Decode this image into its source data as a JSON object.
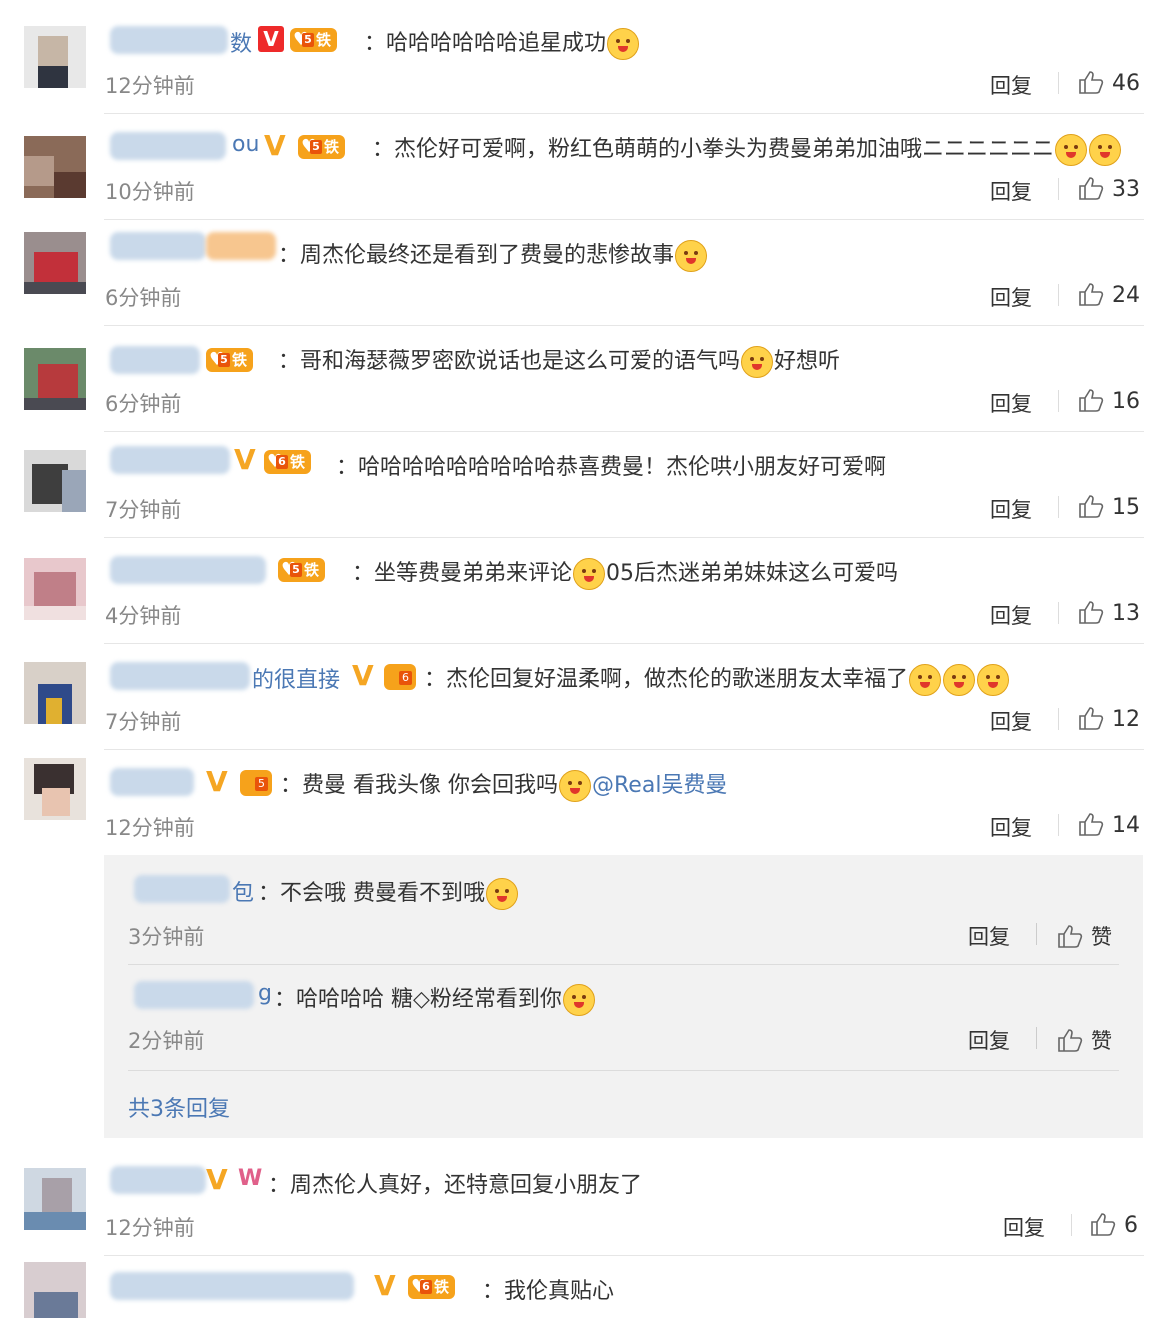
{
  "colors": {
    "link": "#4b78b4",
    "fan_badge": "#f6a21b",
    "v_badge": "#ee2a2a",
    "v_mark": "#f5a623"
  },
  "labels": {
    "reply": "回复",
    "like": "赞",
    "fan_badge_text": "铁粉",
    "fan_level": "5",
    "fan_level_b": "6",
    "v_letter": "V"
  },
  "comments": [
    {
      "name_part": "数",
      "text": "：哈哈哈哈哈哈追星成功",
      "time": "12分钟前",
      "likes": "46"
    },
    {
      "name_part": "ou",
      "text": "：杰伦好可爱啊，粉红色萌萌的小拳头为费曼弟弟加油哦ニニニニニニ",
      "time": "10分钟前",
      "likes": "33"
    },
    {
      "name_part": "",
      "text": "：周杰伦最终还是看到了费曼的悲惨故事",
      "time": "6分钟前",
      "likes": "24"
    },
    {
      "name_part": "",
      "text": "：哥和海瑟薇罗密欧说话也是这么可爱的语气吗",
      "text2": "好想听",
      "time": "6分钟前",
      "likes": "16"
    },
    {
      "name_part": "",
      "text": "：哈哈哈哈哈哈哈哈哈恭喜费曼！杰伦哄小朋友好可爱啊",
      "time": "7分钟前",
      "likes": "15"
    },
    {
      "name_part": "",
      "text": "：坐等费曼弟弟来评论",
      "text2": "05后杰迷弟弟妹妹这么可爱吗",
      "time": "4分钟前",
      "likes": "13"
    },
    {
      "name_part": "的很直接",
      "text": "：杰伦回复好温柔啊，做杰伦的歌迷朋友太幸福了",
      "time": "7分钟前",
      "likes": "12"
    },
    {
      "name_part": "",
      "text": "：费曼 看我头像 你会回我吗",
      "mention": "@Real吴费曼",
      "time": "12分钟前",
      "likes": "14"
    },
    {
      "name_part": "",
      "text": "：周杰伦人真好，还特意回复小朋友了",
      "time": "12分钟前",
      "likes": "6"
    },
    {
      "name_part": "",
      "text": "：我伦真贴心"
    }
  ],
  "replies": [
    {
      "name_part": "包",
      "text": "：不会哦  费曼看不到哦",
      "time": "3分钟前"
    },
    {
      "name_part": "g",
      "text": "：哈哈哈哈 糖◇粉经常看到你",
      "time": "2分钟前"
    }
  ],
  "more_replies": "共3条回复"
}
